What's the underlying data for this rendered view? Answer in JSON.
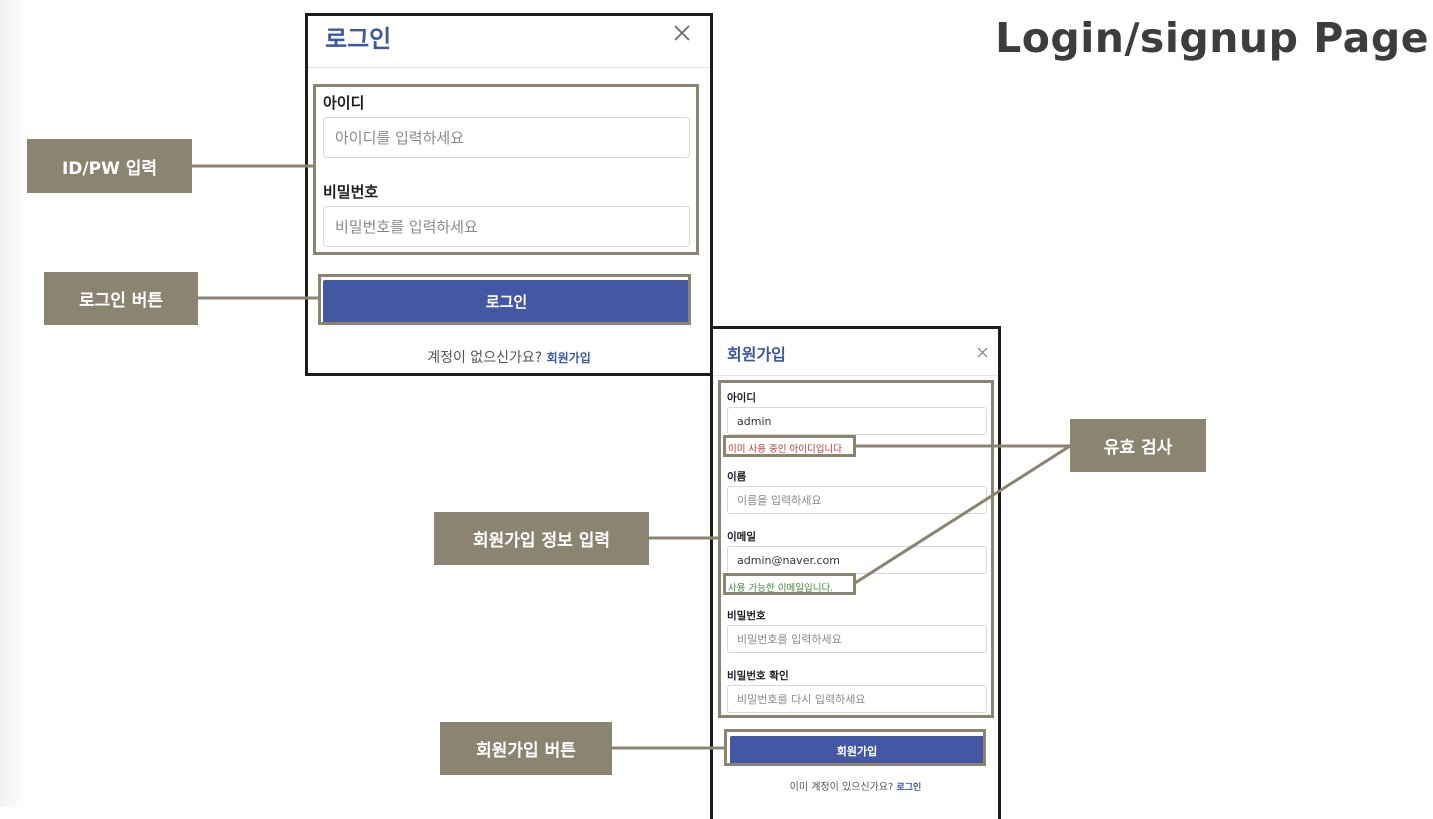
{
  "page": {
    "title": "Login/signup Page"
  },
  "login": {
    "title": "로그인",
    "id_label": "아이디",
    "id_placeholder": "아이디를 입력하세요",
    "pw_label": "비밀번호",
    "pw_placeholder": "비밀번호를 입력하세요",
    "submit_label": "로그인",
    "footer_text": "계정이 없으신가요?",
    "footer_link": "회원가입"
  },
  "signup": {
    "title": "회원가입",
    "id_label": "아이디",
    "id_value": "admin",
    "id_error": "이미 사용 중인 아이디입니다",
    "name_label": "이름",
    "name_placeholder": "이름을 입력하세요",
    "email_label": "이메일",
    "email_value": "admin@naver.com",
    "email_ok": "사용 가능한 이메일입니다.",
    "pw_label": "비밀번호",
    "pw_placeholder": "비밀번호를 입력하세요",
    "pw_confirm_label": "비밀번호 확인",
    "pw_confirm_placeholder": "비밀번호를 다시 입력하세요",
    "submit_label": "회원가입",
    "footer_text": "이미 계정이 있으신가요?",
    "footer_link": "로그인"
  },
  "annotations": {
    "id_pw_input": "ID/PW 입력",
    "login_button": "로그인 버튼",
    "validation": "유효 검사",
    "signup_info_input": "회원가입 정보 입력",
    "signup_button": "회원가입 버튼"
  },
  "icons": {
    "close": "close-icon"
  },
  "colors": {
    "accent": "#3d58a3",
    "button": "#4457a4",
    "annotation": "#8b8470",
    "error": "#c0392b",
    "success": "#3e8a34"
  }
}
